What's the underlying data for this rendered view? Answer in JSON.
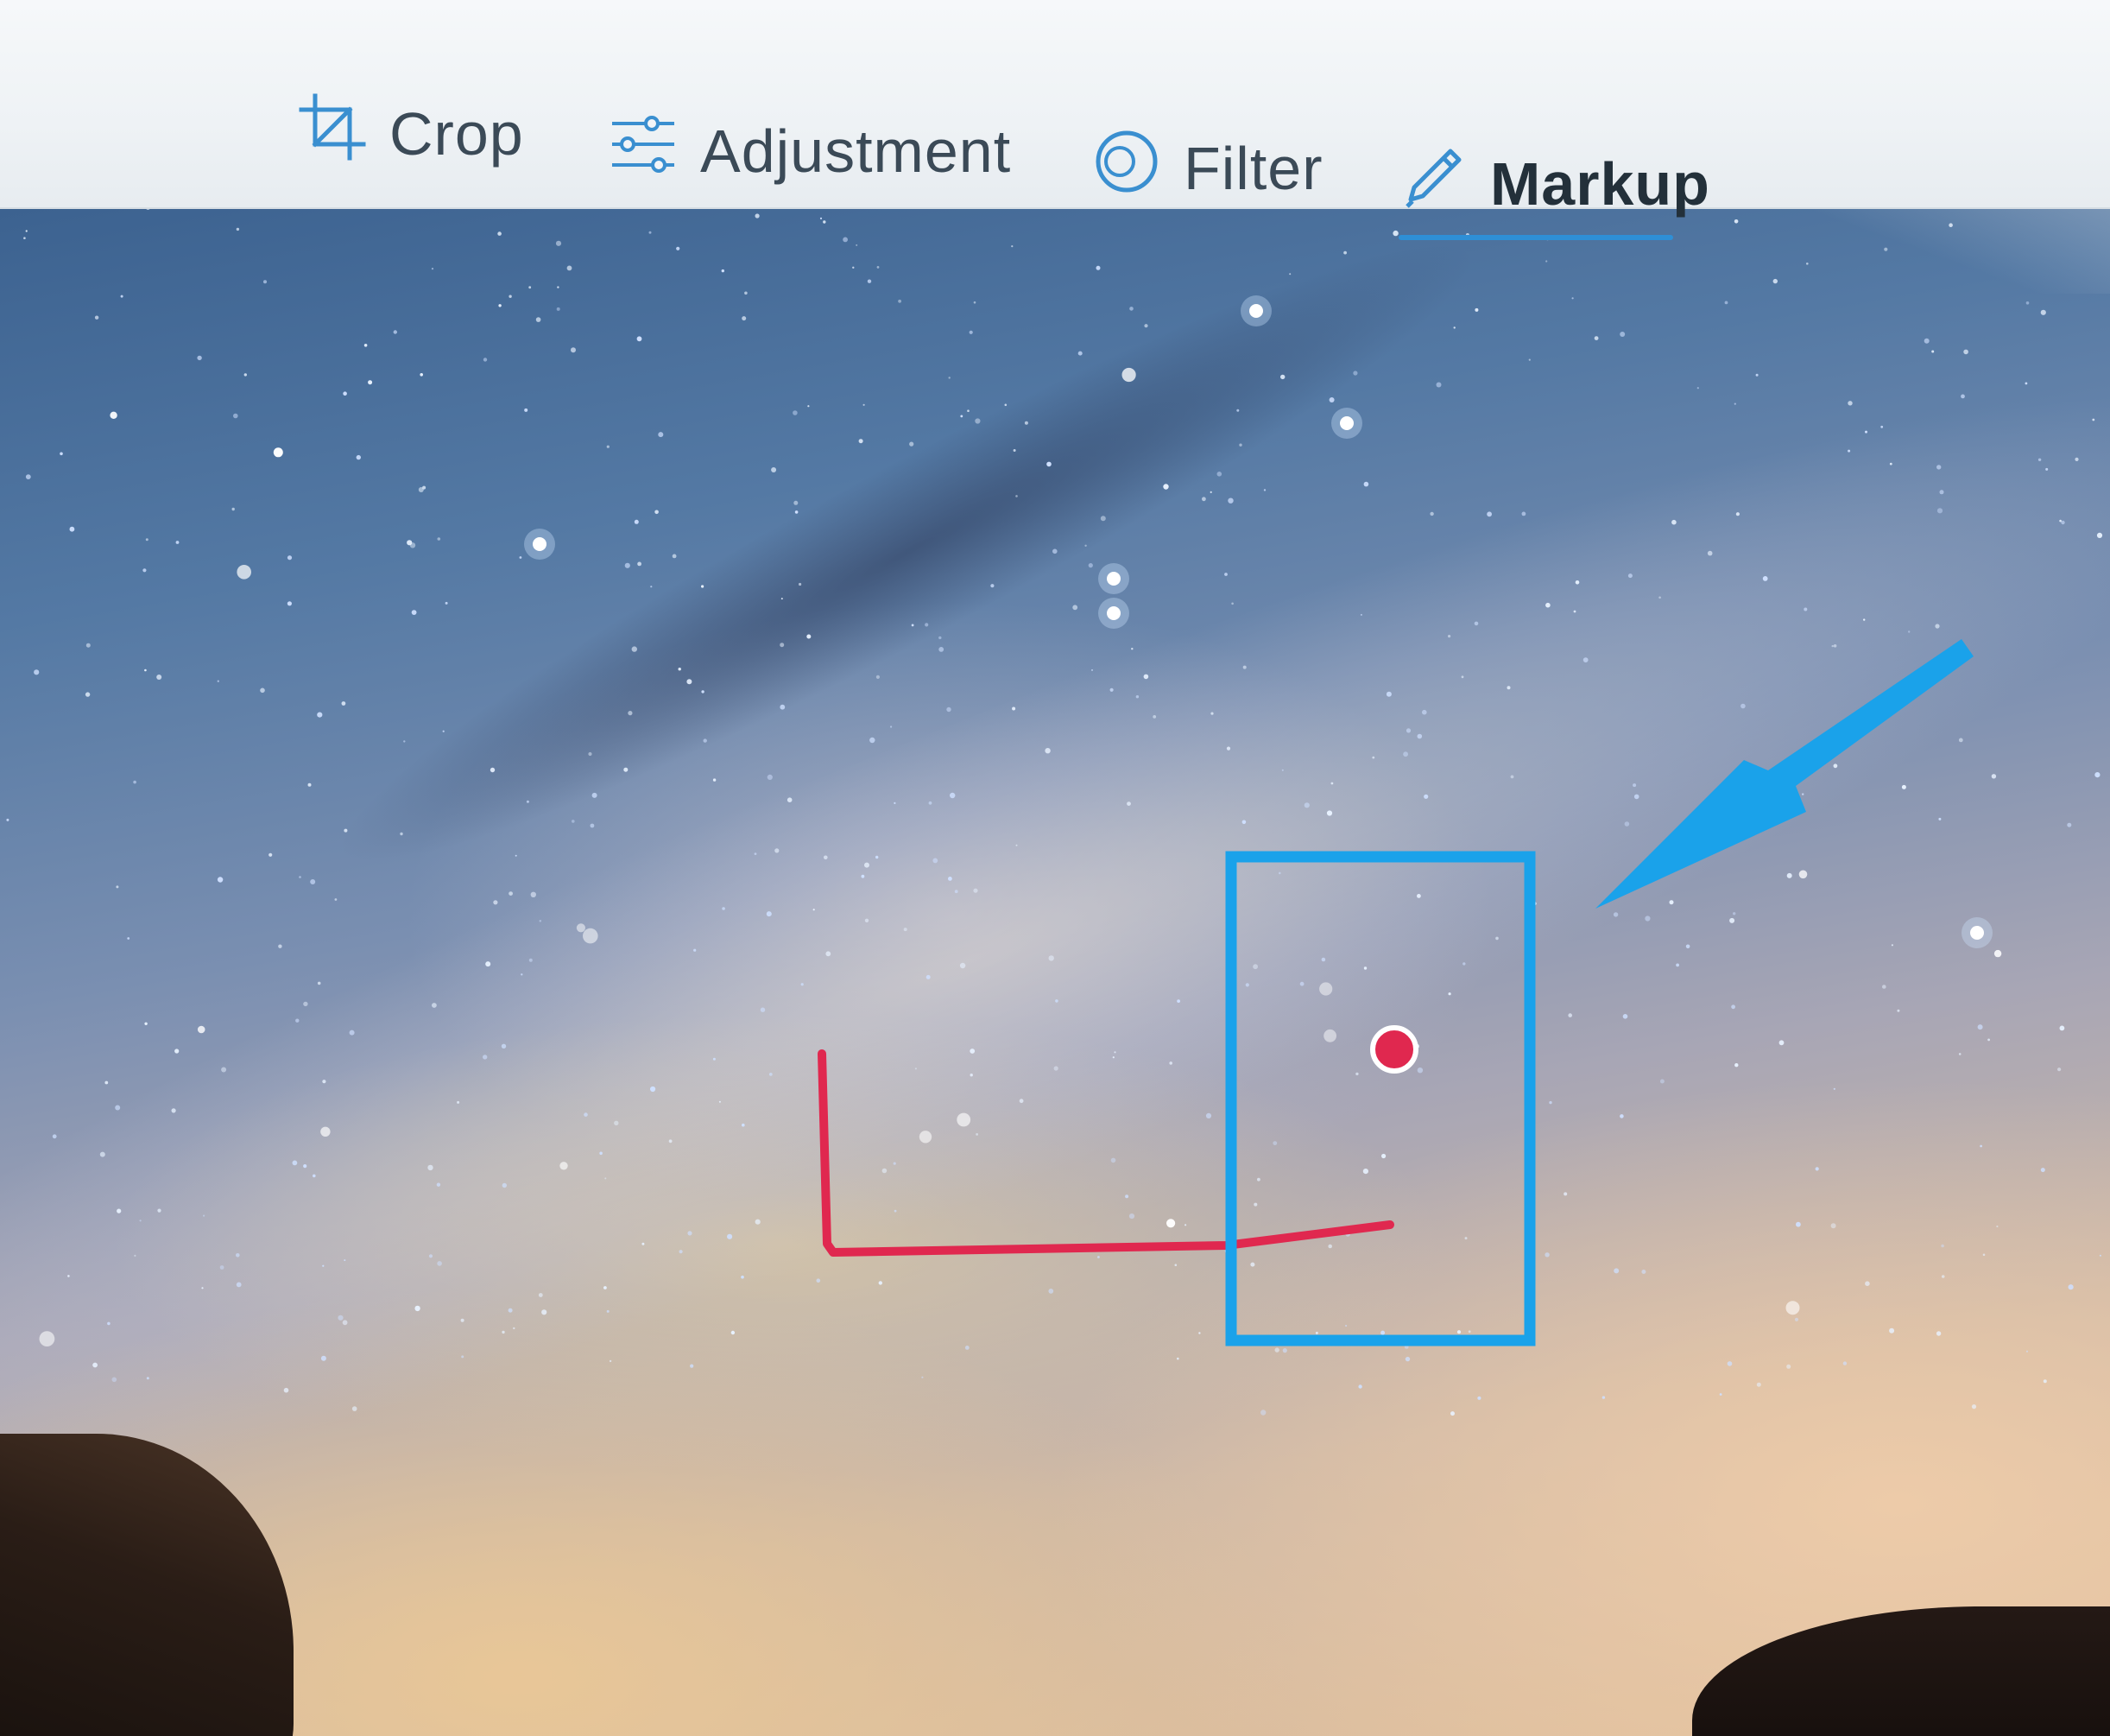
{
  "toolbar": {
    "tabs": [
      {
        "label": "Crop",
        "icon": "crop-icon"
      },
      {
        "label": "Adjustment",
        "icon": "sliders-icon"
      },
      {
        "label": "Filter",
        "icon": "filter-icon"
      },
      {
        "label": "Markup",
        "icon": "pen-icon"
      }
    ],
    "active_tab": "Markup"
  },
  "colors": {
    "accent": "#2e8fd6",
    "icon": "#3a8fd0",
    "markup_red": "#e0284f",
    "markup_blue": "#1aa2ea",
    "text": "#3b4a57"
  },
  "canvas": {
    "annotations": [
      "red L-shaped stroke",
      "blue rectangle",
      "red dot",
      "blue arrow"
    ]
  }
}
